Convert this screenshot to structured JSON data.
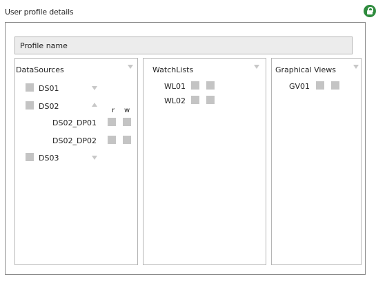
{
  "header": {
    "title": "User profile details"
  },
  "profile": {
    "placeholder": "Profile name"
  },
  "panels": {
    "datasources": {
      "title": "DataSources",
      "rw_labels": {
        "r": "r",
        "w": "w"
      },
      "items": [
        {
          "label": "DS01"
        },
        {
          "label": "DS02",
          "children": [
            {
              "label": "DS02_DP01"
            },
            {
              "label": "DS02_DP02"
            }
          ]
        },
        {
          "label": "DS03"
        }
      ]
    },
    "watchlists": {
      "title": "WatchLists",
      "items": [
        {
          "label": "WL01"
        },
        {
          "label": "WL02"
        }
      ]
    },
    "graphical_views": {
      "title": "Graphical Views",
      "items": [
        {
          "label": "GV01"
        }
      ]
    }
  },
  "icons": {
    "lock": "lock-icon",
    "expand": "chevron-down-icon",
    "collapse": "chevron-up-icon"
  },
  "colors": {
    "lock": "#2e8b3d",
    "checkbox": "#c4c4c4"
  }
}
